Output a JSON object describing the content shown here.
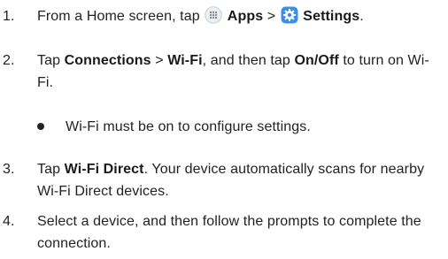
{
  "steps": [
    {
      "num": "1.",
      "parts": [
        {
          "t": "From a Home screen, tap "
        },
        {
          "icon": "apps-icon"
        },
        {
          "t": " "
        },
        {
          "b": "Apps"
        },
        {
          "t": " > "
        },
        {
          "icon": "settings-icon"
        },
        {
          "t": " "
        },
        {
          "b": "Settings"
        },
        {
          "t": "."
        }
      ]
    },
    {
      "num": "2.",
      "parts": [
        {
          "t": "Tap "
        },
        {
          "b": "Connections"
        },
        {
          "t": " > "
        },
        {
          "b": "Wi-Fi"
        },
        {
          "t": ", and then tap "
        },
        {
          "b": "On/Off"
        },
        {
          "t": " to turn on Wi-Fi."
        }
      ]
    },
    {
      "num": "3.",
      "parts": [
        {
          "t": "Tap "
        },
        {
          "b": "Wi-Fi Direct"
        },
        {
          "t": ". Your device automatically scans for nearby Wi-Fi Direct devices."
        }
      ]
    },
    {
      "num": "4.",
      "parts": [
        {
          "t": "Select a device, and then follow the prompts to complete the connection."
        }
      ]
    }
  ],
  "bullet": "Wi-Fi must be on to configure settings.",
  "colors": {
    "text": "#222222",
    "settings_icon": "#3a8fe6",
    "apps_icon": "#cfd4da"
  }
}
